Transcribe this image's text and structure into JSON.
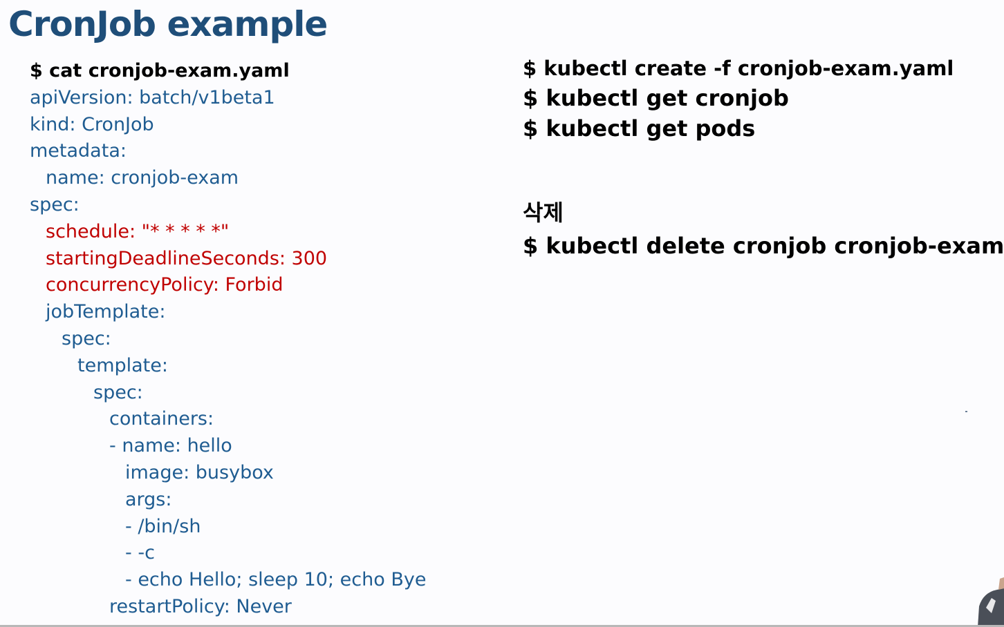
{
  "slide": {
    "title": "CronJob example",
    "yaml_lines": [
      {
        "text": "$ cat cronjob-exam.yaml",
        "indent": 0,
        "style": "cmd"
      },
      {
        "text": "apiVersion: batch/v1beta1",
        "indent": 0,
        "style": "normal"
      },
      {
        "text": "kind: CronJob",
        "indent": 0,
        "style": "normal"
      },
      {
        "text": "metadata:",
        "indent": 0,
        "style": "normal"
      },
      {
        "text": "name: cronjob-exam",
        "indent": 1,
        "style": "normal"
      },
      {
        "text": "spec:",
        "indent": 0,
        "style": "normal"
      },
      {
        "text": "schedule: \"* * * * *\"",
        "indent": 1,
        "style": "highlight"
      },
      {
        "text": "startingDeadlineSeconds: 300",
        "indent": 1,
        "style": "highlight"
      },
      {
        "text": "concurrencyPolicy: Forbid",
        "indent": 1,
        "style": "highlight"
      },
      {
        "text": "jobTemplate:",
        "indent": 1,
        "style": "normal"
      },
      {
        "text": "spec:",
        "indent": 2,
        "style": "normal"
      },
      {
        "text": "template:",
        "indent": 3,
        "style": "normal"
      },
      {
        "text": "spec:",
        "indent": 4,
        "style": "normal"
      },
      {
        "text": "containers:",
        "indent": 5,
        "style": "normal"
      },
      {
        "text": "- name: hello",
        "indent": 5,
        "style": "normal"
      },
      {
        "text": "image: busybox",
        "indent": 6,
        "style": "normal"
      },
      {
        "text": "args:",
        "indent": 6,
        "style": "normal"
      },
      {
        "text": "- /bin/sh",
        "indent": 6,
        "style": "normal"
      },
      {
        "text": "- -c",
        "indent": 6,
        "style": "normal"
      },
      {
        "text": "- echo Hello; sleep 10; echo Bye",
        "indent": 6,
        "style": "normal"
      },
      {
        "text": "restartPolicy: Never",
        "indent": 5,
        "style": "normal"
      }
    ],
    "commands": [
      "$ kubectl create -f cronjob-exam.yaml",
      "$ kubectl get cronjob",
      "$ kubectl get pods"
    ],
    "delete_heading": "삭제",
    "delete_command": "$ kubectl delete cronjob cronjob-exam"
  },
  "colors": {
    "title": "#1f4e79",
    "yaml_text": "#1f5c91",
    "highlight": "#c00000",
    "command": "#000000"
  }
}
